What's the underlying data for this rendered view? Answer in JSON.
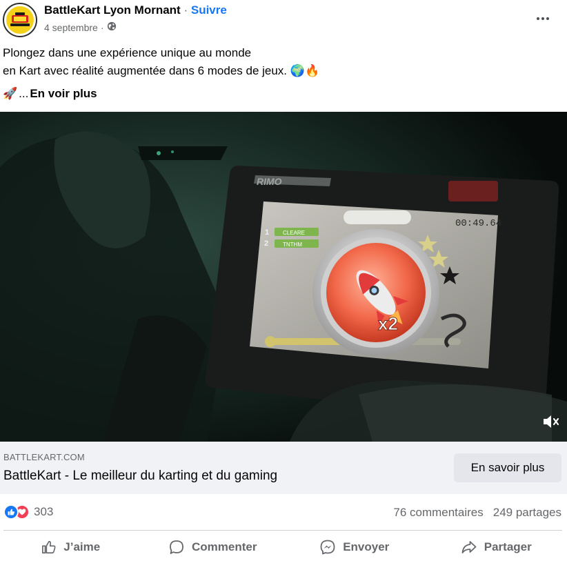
{
  "post": {
    "page_name": "BattleKart Lyon Mornant",
    "separator": "·",
    "follow_label": "Suivre",
    "date": "4 septembre",
    "date_separator": "·",
    "text_line1": "Plongez dans une expérience unique au monde",
    "text_line2": "en Kart avec réalité augmentée dans 6 modes de jeux.",
    "emoji_globe": "🌍",
    "emoji_fire": "🔥",
    "emoji_rocket": "🚀",
    "ellipsis": "...",
    "see_more_label": "En voir plus"
  },
  "video": {
    "timer": "00:49.64",
    "multiplier": "x2",
    "brand_text": "RIMO",
    "leaderboard": [
      {
        "rank": "1",
        "name": "CLEARE"
      },
      {
        "rank": "2",
        "name": "TNTHM"
      }
    ]
  },
  "link_card": {
    "domain": "BATTLEKART.COM",
    "title": "BattleKart - Le meilleur du karting et du gaming",
    "cta_label": "En savoir plus"
  },
  "stats": {
    "reactions_count": "303",
    "comments": "76 commentaires",
    "shares": "249 partages"
  },
  "actions": {
    "like": "J’aime",
    "comment": "Commenter",
    "send": "Envoyer",
    "share": "Partager"
  },
  "colors": {
    "accent": "#1877f2",
    "secondary_text": "#65676b",
    "love": "#f33e58",
    "card_bg": "#f0f2f5"
  },
  "icons": [
    "globe-icon",
    "more-icon",
    "like-reaction-icon",
    "love-reaction-icon",
    "thumbs-up-icon",
    "comment-icon",
    "messenger-icon",
    "share-icon",
    "mute-icon"
  ]
}
